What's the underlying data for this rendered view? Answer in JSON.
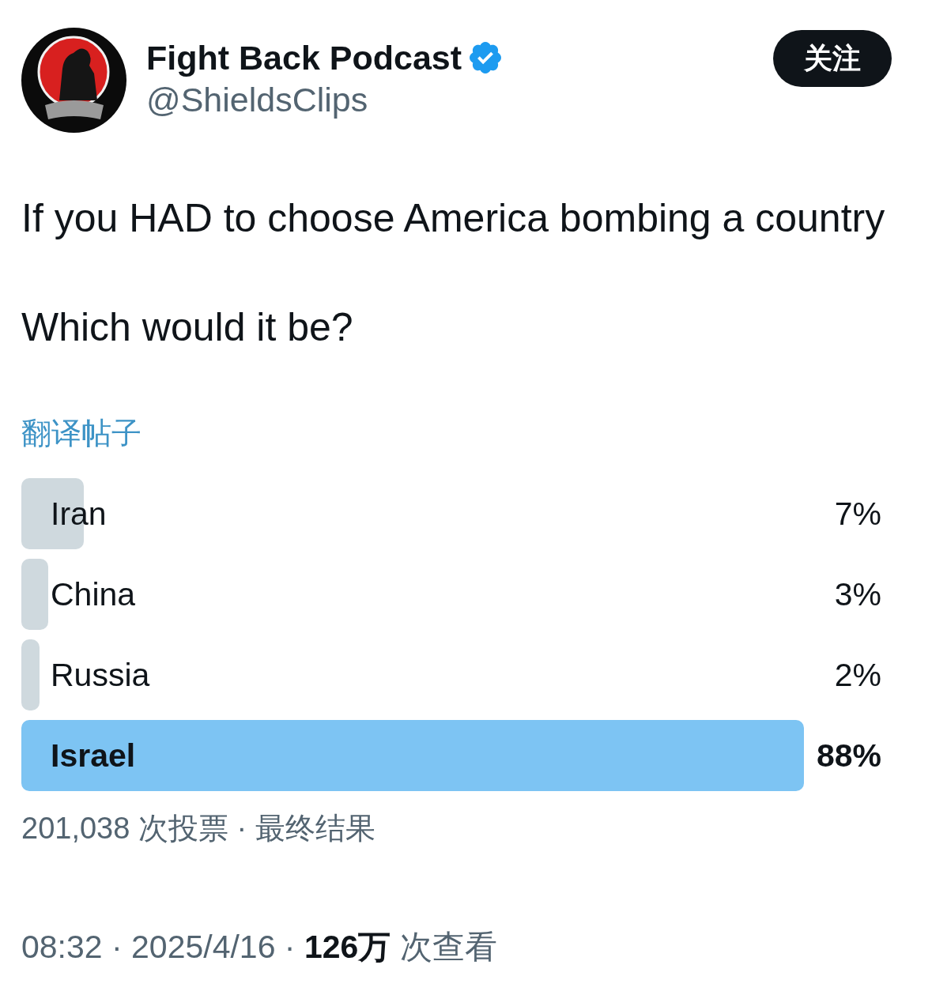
{
  "author": {
    "name": "Fight Back Podcast",
    "verified": true,
    "handle": "@ShieldsClips"
  },
  "follow_button": {
    "label": "关注"
  },
  "post": {
    "paragraphs": [
      "If you HAD to choose America bombing a country",
      "Which would it be?"
    ],
    "translate_link": "翻译帖子"
  },
  "poll": {
    "options": [
      {
        "label": "Iran",
        "level": 0.07,
        "percent": "7%",
        "winner": false
      },
      {
        "label": "China",
        "level": 0.03,
        "percent": "3%",
        "winner": false
      },
      {
        "label": "Russia",
        "level": 0.02,
        "percent": "2%",
        "winner": false
      },
      {
        "label": "Israel",
        "level": 0.88,
        "percent": "88%",
        "winner": true
      }
    ],
    "summary": "201,038 次投票 · 最终结果"
  },
  "meta": {
    "line": "08:32 · 2025/4/16 · **126万** 次查看"
  }
}
